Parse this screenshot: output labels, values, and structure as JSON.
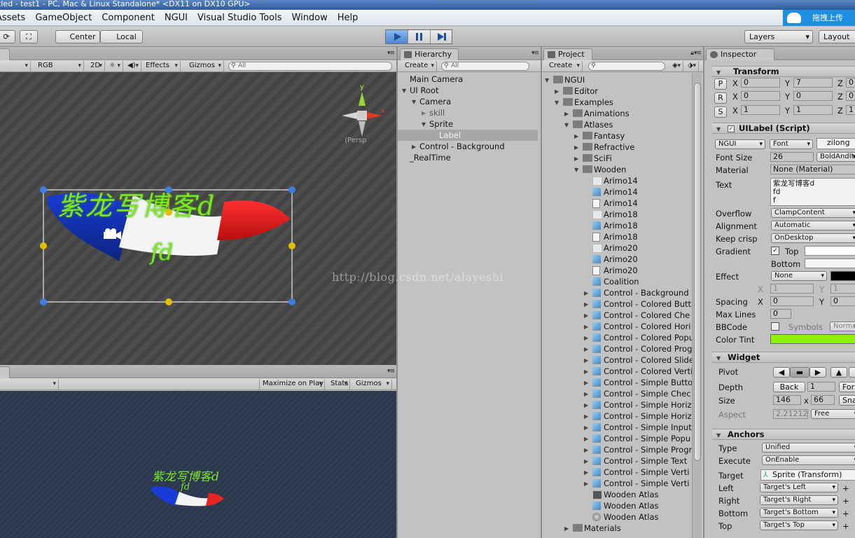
{
  "window": {
    "title": "itled - test1 - PC, Mac & Linux Standalone* <DX11 on DX10 GPU>"
  },
  "menu": [
    "Assets",
    "GameObject",
    "Component",
    "NGUI",
    "Visual Studio Tools",
    "Window",
    "Help"
  ],
  "upload_button": "拖拽上传",
  "toolbar": {
    "center": "Center",
    "local": "Local",
    "layers": "Layers",
    "layout": "Layout"
  },
  "scene": {
    "toolbar": {
      "rgb": "RGB",
      "mode2d": "2D",
      "effects": "Effects",
      "gizmos": "Gizmos",
      "search": "All"
    },
    "persp": "Persp",
    "gizmo_axes": {
      "y": "y",
      "x": "x"
    },
    "label_text": "紫龙写博客d",
    "label_text2": "fd"
  },
  "watermark": "http://blog.csdn.net/alayeshi",
  "game": {
    "maximize": "Maximize on Play",
    "stats": "Stats",
    "gizmos": "Gizmos",
    "label_text": "紫龙写博客d",
    "label_text2": "fd"
  },
  "hierarchy": {
    "tab": "Hierarchy",
    "create": "Create",
    "search": "All",
    "items": [
      {
        "label": "Main Camera"
      },
      {
        "label": "UI Root"
      },
      {
        "label": "Camera"
      },
      {
        "label": "skill"
      },
      {
        "label": "Sprite"
      },
      {
        "label": "Label"
      },
      {
        "label": "Control - Background"
      },
      {
        "label": "_RealTime"
      }
    ]
  },
  "project": {
    "tab": "Project",
    "create": "Create",
    "items": [
      {
        "label": "NGUI"
      },
      {
        "label": "Editor"
      },
      {
        "label": "Examples"
      },
      {
        "label": "Animations"
      },
      {
        "label": "Atlases"
      },
      {
        "label": "Fantasy"
      },
      {
        "label": "Refractive"
      },
      {
        "label": "SciFi"
      },
      {
        "label": "Wooden"
      },
      {
        "label": "Arimo14"
      },
      {
        "label": "Arimo14"
      },
      {
        "label": "Arimo14"
      },
      {
        "label": "Arimo18"
      },
      {
        "label": "Arimo18"
      },
      {
        "label": "Arimo18"
      },
      {
        "label": "Arimo20"
      },
      {
        "label": "Arimo20"
      },
      {
        "label": "Arimo20"
      },
      {
        "label": "Coalition"
      },
      {
        "label": "Control - Background"
      },
      {
        "label": "Control - Colored Butt"
      },
      {
        "label": "Control - Colored Che"
      },
      {
        "label": "Control - Colored Hori"
      },
      {
        "label": "Control - Colored Popu"
      },
      {
        "label": "Control - Colored Prog"
      },
      {
        "label": "Control - Colored Slide"
      },
      {
        "label": "Control - Colored Verti"
      },
      {
        "label": "Control - Simple Butto"
      },
      {
        "label": "Control - Simple Chec"
      },
      {
        "label": "Control - Simple Horiz"
      },
      {
        "label": "Control - Simple Horiz"
      },
      {
        "label": "Control - Simple Input"
      },
      {
        "label": "Control - Simple Popu"
      },
      {
        "label": "Control - Simple Progr"
      },
      {
        "label": "Control - Simple Text"
      },
      {
        "label": "Control - Simple Verti"
      },
      {
        "label": "Control - Simple Verti"
      },
      {
        "label": "Wooden Atlas"
      },
      {
        "label": "Wooden Atlas"
      },
      {
        "label": "Wooden Atlas"
      },
      {
        "label": "Materials"
      }
    ]
  },
  "inspector": {
    "tab": "Inspector",
    "transform": {
      "title": "Transform",
      "p": {
        "btn": "P",
        "x": "0",
        "y": "7",
        "z": "0"
      },
      "r": {
        "btn": "R",
        "x": "0",
        "y": "0",
        "z": "0"
      },
      "s": {
        "btn": "S",
        "x": "1",
        "y": "1",
        "z": "1"
      },
      "lx": "X",
      "ly": "Y",
      "lz": "Z"
    },
    "uilabel": {
      "title": "UILabel (Script)",
      "font_name": "zilong",
      "font_type": "NGUI",
      "font_btn": "Font",
      "font_size_label": "Font Size",
      "font_size": "26",
      "font_style": "BoldAndItalic",
      "material_label": "Material",
      "material": "None (Material)",
      "text_label": "Text",
      "text_lines": [
        "紫龙写博客d",
        "fd",
        "f"
      ],
      "overflow_label": "Overflow",
      "overflow": "ClampContent",
      "alignment_label": "Alignment",
      "alignment": "Automatic",
      "keepcrisp_label": "Keep crisp",
      "keepcrisp": "OnDesktop",
      "gradient_label": "Gradient",
      "gradient_top": "Top",
      "gradient_bottom": "Bottom",
      "effect_label": "Effect",
      "effect": "None",
      "effect_x": "1",
      "effect_y": "1",
      "spacing_label": "Spacing",
      "spacing_x": "0",
      "spacing_y": "0",
      "maxlines_label": "Max Lines",
      "maxlines": "0",
      "bbcode_label": "BBCode",
      "symbols_label": "Symbols",
      "symbols": "Normal",
      "colortint_label": "Color Tint",
      "tint_color": "#8cf20a"
    },
    "widget": {
      "title": "Widget",
      "pivot_label": "Pivot",
      "depth_label": "Depth",
      "depth_back": "Back",
      "depth": "1",
      "depth_forward": "Forward",
      "size_label": "Size",
      "width": "146",
      "times": "x",
      "height": "66",
      "snap": "Snap",
      "aspect_label": "Aspect",
      "aspect": "2.212121",
      "aspect_mode": "Free"
    },
    "anchors": {
      "title": "Anchors",
      "type_label": "Type",
      "type": "Unified",
      "execute_label": "Execute",
      "execute": "OnEnable",
      "target_label": "Target",
      "target": "Sprite (Transform)",
      "left_label": "Left",
      "left": "Target's Left",
      "right_label": "Right",
      "right": "Target's Right",
      "bottom_label": "Bottom",
      "bottom": "Target's Bottom",
      "top_label": "Top",
      "top": "Target's Top",
      "plus": "+"
    }
  }
}
